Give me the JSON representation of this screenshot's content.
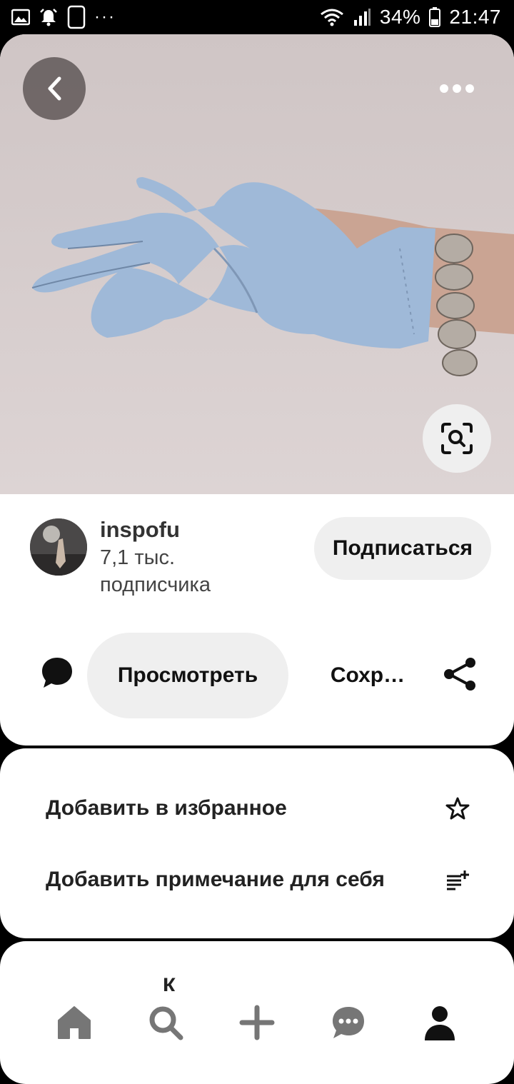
{
  "status_bar": {
    "battery": "34%",
    "time": "21:47",
    "icons": [
      "gallery-icon",
      "alarm-icon",
      "phone-outline-icon",
      "more-dots-icon",
      "wifi-icon",
      "signal-icon",
      "battery-icon"
    ]
  },
  "pin": {
    "image_description_icon": "blue-glove-photo",
    "back_icon": "chevron-left-icon",
    "more_icon": "more-horizontal-icon",
    "lens_icon": "visual-search-icon"
  },
  "creator": {
    "name": "inspofu",
    "followers_line1": "7,1 тыс.",
    "followers_line2": "подписчика",
    "follow_label": "Подписаться"
  },
  "actions": {
    "view_label": "Просмотреть",
    "save_label": "Сохр…"
  },
  "options": [
    {
      "label": "Добавить в избранное",
      "icon": "star-outline-icon"
    },
    {
      "label": "Добавить примечание для себя",
      "icon": "note-add-icon"
    }
  ],
  "peek": {
    "text": "К"
  },
  "bottom_nav": [
    {
      "name": "home",
      "icon": "home-icon"
    },
    {
      "name": "search",
      "icon": "search-icon"
    },
    {
      "name": "create",
      "icon": "plus-icon"
    },
    {
      "name": "messages",
      "icon": "chat-icon"
    },
    {
      "name": "profile",
      "icon": "profile-icon"
    }
  ],
  "colors": {
    "background": "#000000",
    "card": "#ffffff",
    "pill": "#efefef",
    "image_bg": "#d3c9c9",
    "glove": "#9fb9d8",
    "text": "#111111",
    "nav_icon": "#767676"
  }
}
